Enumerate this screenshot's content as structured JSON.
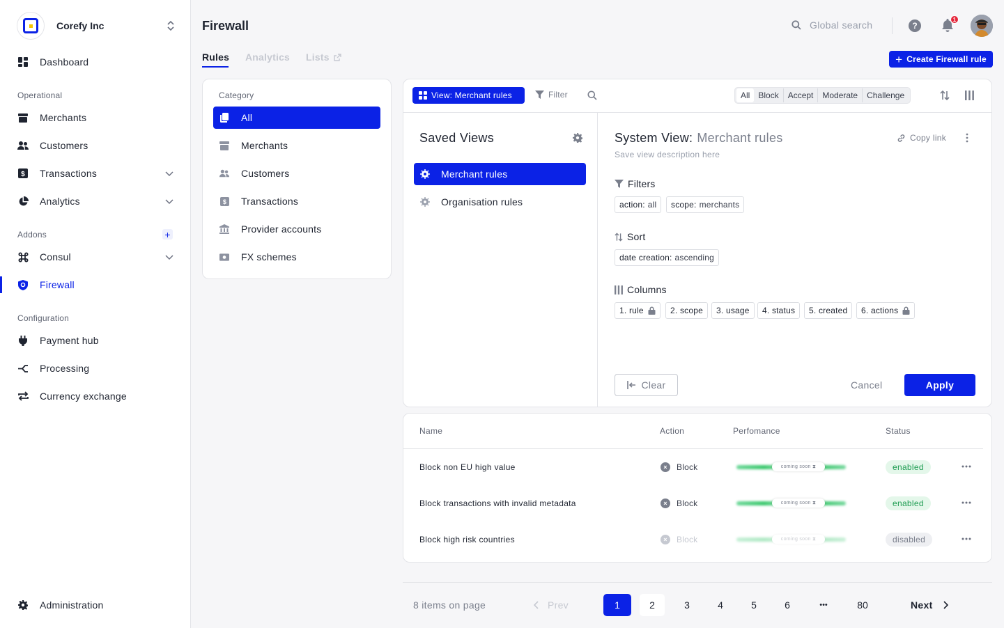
{
  "org": {
    "name": "Corefy Inc"
  },
  "sidebar": {
    "main": [
      {
        "label": "Dashboard"
      }
    ],
    "operational_title": "Operational",
    "operational": [
      {
        "label": "Merchants"
      },
      {
        "label": "Customers"
      },
      {
        "label": "Transactions"
      },
      {
        "label": "Analytics"
      }
    ],
    "addons_title": "Addons",
    "addons": [
      {
        "label": "Consul"
      },
      {
        "label": "Firewall"
      }
    ],
    "configuration_title": "Configuration",
    "configuration": [
      {
        "label": "Payment hub"
      },
      {
        "label": "Processing"
      },
      {
        "label": "Currency exchange"
      }
    ],
    "footer": {
      "label": "Administration"
    },
    "active": "Firewall",
    "accent": "#0b22e6"
  },
  "header": {
    "title": "Firewall",
    "search_placeholder": "Global search",
    "help": "?",
    "notification_count": "1"
  },
  "tabs": {
    "rules": "Rules",
    "analytics": "Analytics",
    "lists": "Lists",
    "create_button": "Create Firewall rule"
  },
  "category": {
    "title": "Category",
    "items": [
      {
        "label": "All"
      },
      {
        "label": "Merchants"
      },
      {
        "label": "Customers"
      },
      {
        "label": "Transactions"
      },
      {
        "label": "Provider accounts"
      },
      {
        "label": "FX schemes"
      }
    ],
    "selected": "All"
  },
  "toolbar": {
    "view_label": "View: Merchant rules",
    "filter_label": "Filter",
    "segments": [
      "All",
      "Block",
      "Accept",
      "Moderate",
      "Challenge"
    ],
    "segment_selected": "All"
  },
  "saved_views": {
    "title": "Saved Views",
    "items": [
      {
        "label": "Merchant rules"
      },
      {
        "label": "Organisation rules"
      }
    ],
    "selected": "Merchant rules"
  },
  "system_view": {
    "title": "System View:",
    "name": "Merchant rules",
    "copy_link": "Copy link",
    "description": "Save view description here",
    "filters_title": "Filters",
    "filters": [
      {
        "key": "action:",
        "value": "all"
      },
      {
        "key": "scope:",
        "value": "merchants"
      }
    ],
    "sort_title": "Sort",
    "sort": [
      {
        "key": "date creation:",
        "value": "ascending"
      }
    ],
    "columns_title": "Columns",
    "columns": [
      {
        "label": "1. rule",
        "locked": true
      },
      {
        "label": "2. scope",
        "locked": false
      },
      {
        "label": "3. usage",
        "locked": false
      },
      {
        "label": "4. status",
        "locked": false
      },
      {
        "label": "5. created",
        "locked": false
      },
      {
        "label": "6. actions",
        "locked": true
      }
    ],
    "clear": "Clear",
    "cancel": "Cancel",
    "apply": "Apply"
  },
  "table": {
    "headers": {
      "name": "Name",
      "action": "Action",
      "performance": "Perfomance",
      "status": "Status"
    },
    "rows": [
      {
        "name": "Block non EU high value",
        "action": "Block",
        "performance": "coming soon",
        "status": "enabled"
      },
      {
        "name": "Block transactions with invalid metadata",
        "action": "Block",
        "performance": "coming soon",
        "status": "enabled"
      },
      {
        "name": "Block high risk countries",
        "action": "Block",
        "performance": "coming soon",
        "status": "disabled"
      }
    ]
  },
  "pagination": {
    "info": "8 items on page",
    "prev": "Prev",
    "next": "Next",
    "pages": [
      "1",
      "2",
      "3",
      "4",
      "5",
      "6",
      "•••",
      "80"
    ],
    "current": "1"
  }
}
